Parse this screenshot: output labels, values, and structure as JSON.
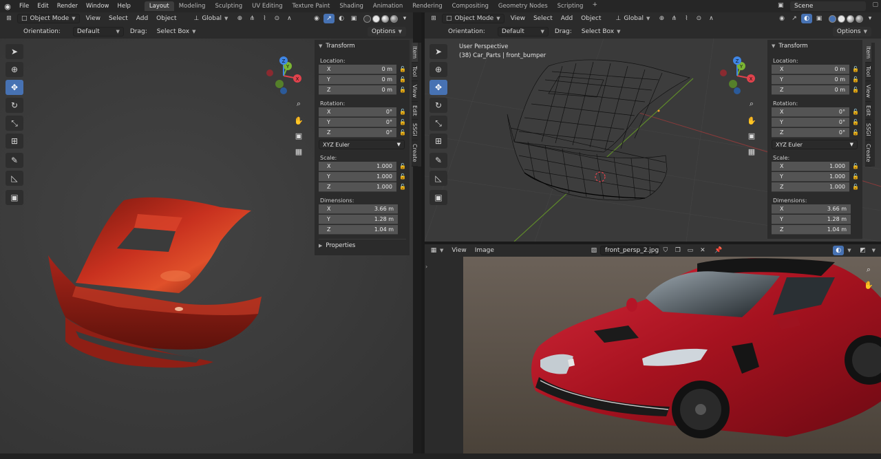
{
  "menu": [
    "File",
    "Edit",
    "Render",
    "Window",
    "Help"
  ],
  "workspaces": [
    "Layout",
    "Modeling",
    "Sculpting",
    "UV Editing",
    "Texture Paint",
    "Shading",
    "Animation",
    "Rendering",
    "Compositing",
    "Geometry Nodes",
    "Scripting"
  ],
  "workspace_add": "+",
  "scene": "Scene",
  "viewport_header": {
    "mode": "Object Mode",
    "view": "View",
    "select": "Select",
    "add": "Add",
    "object": "Object",
    "transform_orientation": "Global"
  },
  "tool_header": {
    "orientation_label": "Orientation:",
    "orientation_value": "Default",
    "drag_label": "Drag:",
    "drag_value": "Select Box",
    "options": "Options"
  },
  "right_viewport_overlay": {
    "perspective": "User Perspective",
    "object_info": "(38) Car_Parts | front_bumper"
  },
  "transform_panel": {
    "title": "Transform",
    "location_label": "Location:",
    "location": [
      {
        "axis": "X",
        "value": "0 m"
      },
      {
        "axis": "Y",
        "value": "0 m"
      },
      {
        "axis": "Z",
        "value": "0 m"
      }
    ],
    "rotation_label": "Rotation:",
    "rotation": [
      {
        "axis": "X",
        "value": "0°"
      },
      {
        "axis": "Y",
        "value": "0°"
      },
      {
        "axis": "Z",
        "value": "0°"
      }
    ],
    "rotation_mode": "XYZ Euler",
    "scale_label": "Scale:",
    "scale": [
      {
        "axis": "X",
        "value": "1.000"
      },
      {
        "axis": "Y",
        "value": "1.000"
      },
      {
        "axis": "Z",
        "value": "1.000"
      }
    ],
    "dimensions_label": "Dimensions:",
    "dimensions": [
      {
        "axis": "X",
        "value": "3.66 m"
      },
      {
        "axis": "Y",
        "value": "1.28 m"
      },
      {
        "axis": "Z",
        "value": "1.04 m"
      }
    ],
    "properties": "Properties"
  },
  "side_tabs": [
    "Item",
    "Tool",
    "View",
    "Edit",
    "SSGI",
    "Create"
  ],
  "gizmo_axes": {
    "x": "X",
    "y": "Y",
    "z": "Z"
  },
  "image_editor": {
    "view": "View",
    "image": "Image",
    "image_name": "front_persp_2.jpg"
  },
  "colors": {
    "accent": "#4772b3",
    "car_red": "#b8281e",
    "axis_x": "#e0424c",
    "axis_y": "#7bb534",
    "axis_z": "#3f86e6"
  }
}
